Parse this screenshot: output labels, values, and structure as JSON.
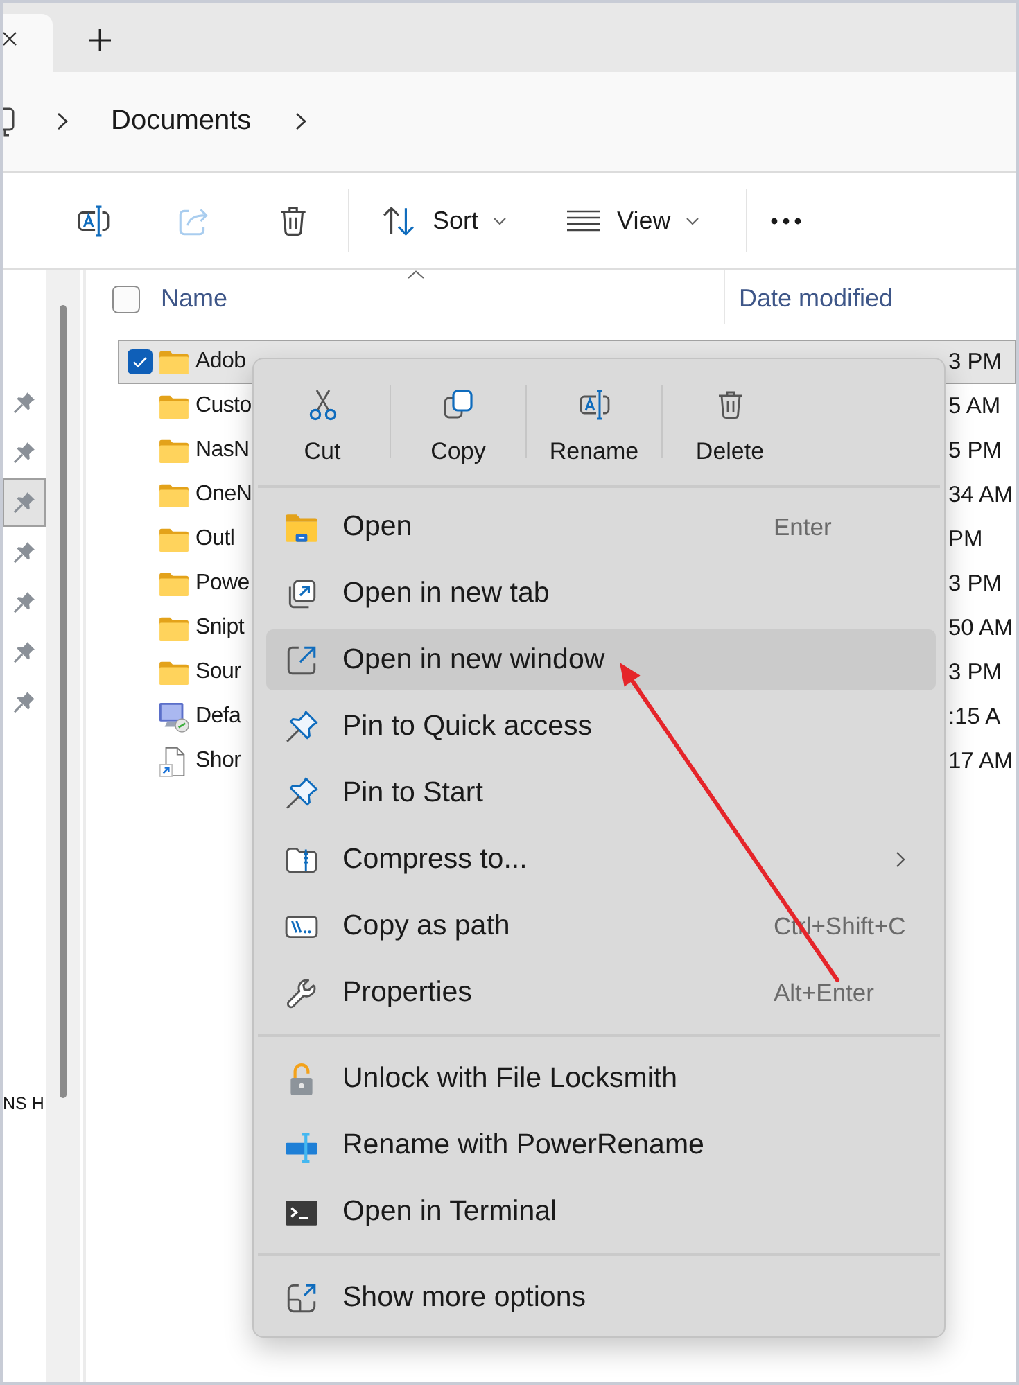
{
  "tab_bar": {
    "tabs": [
      {
        "selected": true
      }
    ]
  },
  "address_bar": {
    "breadcrumbs": [
      "Documents"
    ]
  },
  "toolbar": {
    "icon_buttons": [
      {
        "kind": "rename",
        "disabled": false
      },
      {
        "kind": "share",
        "disabled": true
      },
      {
        "kind": "delete",
        "disabled": false
      }
    ],
    "menus": [
      {
        "kind": "sort",
        "label": "Sort"
      },
      {
        "kind": "view",
        "label": "View"
      }
    ]
  },
  "sidebar": {
    "pinned_items": [
      {
        "selected": false
      },
      {
        "selected": false
      },
      {
        "selected": true
      },
      {
        "selected": false
      },
      {
        "selected": false
      },
      {
        "selected": false
      },
      {
        "selected": false
      }
    ],
    "items": [
      {
        "label": "NS H"
      }
    ]
  },
  "file_list": {
    "select_all": {
      "checked": false
    },
    "columns": [
      {
        "label": "Name",
        "sorted": true
      },
      {
        "label": "Date modified",
        "sorted": false
      }
    ],
    "rows": [
      {
        "kind": "folder",
        "name": "Adob",
        "date_modified": "3 PM",
        "selected": true
      },
      {
        "kind": "folder",
        "name": "Custo",
        "date_modified": "5 AM",
        "selected": false
      },
      {
        "kind": "folder",
        "name": "NasN",
        "date_modified": "5 PM",
        "selected": false
      },
      {
        "kind": "folder",
        "name": "OneN",
        "date_modified": "34 AM",
        "selected": false
      },
      {
        "kind": "folder",
        "name": "Outl",
        "date_modified": "PM",
        "selected": false
      },
      {
        "kind": "folder",
        "name": "Powe",
        "date_modified": "3 PM",
        "selected": false
      },
      {
        "kind": "folder",
        "name": "Snipt",
        "date_modified": "50 AM",
        "selected": false
      },
      {
        "kind": "folder",
        "name": "Sour",
        "date_modified": "3 PM",
        "selected": false
      },
      {
        "kind": "remote-desktop",
        "name": "Defa",
        "date_modified": ":15 A",
        "selected": false
      },
      {
        "kind": "shortcut",
        "name": "Shor",
        "date_modified": "17 AM",
        "selected": false
      }
    ]
  },
  "context_menu": {
    "actions": [
      {
        "kind": "cut",
        "label": "Cut"
      },
      {
        "kind": "copy",
        "label": "Copy"
      },
      {
        "kind": "rename",
        "label": "Rename"
      },
      {
        "kind": "delete",
        "label": "Delete"
      }
    ],
    "groups": [
      {
        "items": [
          {
            "kind": "open",
            "label": "Open",
            "shortcut": "Enter",
            "selected": false,
            "submenu": false
          },
          {
            "kind": "new-tab",
            "label": "Open in new tab",
            "selected": false,
            "submenu": false
          },
          {
            "kind": "new-window",
            "label": "Open in new window",
            "selected": true,
            "submenu": false
          },
          {
            "kind": "pin",
            "label": "Pin to Quick access",
            "selected": false,
            "submenu": false
          },
          {
            "kind": "pin",
            "label": "Pin to Start",
            "selected": false,
            "submenu": false
          },
          {
            "kind": "compress",
            "label": "Compress to...",
            "selected": false,
            "submenu": true
          },
          {
            "kind": "copy-path",
            "label": "Copy as path",
            "shortcut": "Ctrl+Shift+C",
            "selected": false,
            "submenu": false
          },
          {
            "kind": "properties",
            "label": "Properties",
            "shortcut": "Alt+Enter",
            "selected": false,
            "submenu": false
          }
        ]
      },
      {
        "items": [
          {
            "kind": "lock",
            "label": "Unlock with File Locksmith",
            "selected": false,
            "submenu": false
          },
          {
            "kind": "power-rename",
            "label": "Rename with PowerRename",
            "selected": false,
            "submenu": false
          },
          {
            "kind": "terminal",
            "label": "Open in Terminal",
            "selected": false,
            "submenu": false
          }
        ]
      },
      {
        "items": [
          {
            "kind": "more",
            "label": "Show more options",
            "selected": false,
            "submenu": false
          }
        ]
      }
    ]
  }
}
